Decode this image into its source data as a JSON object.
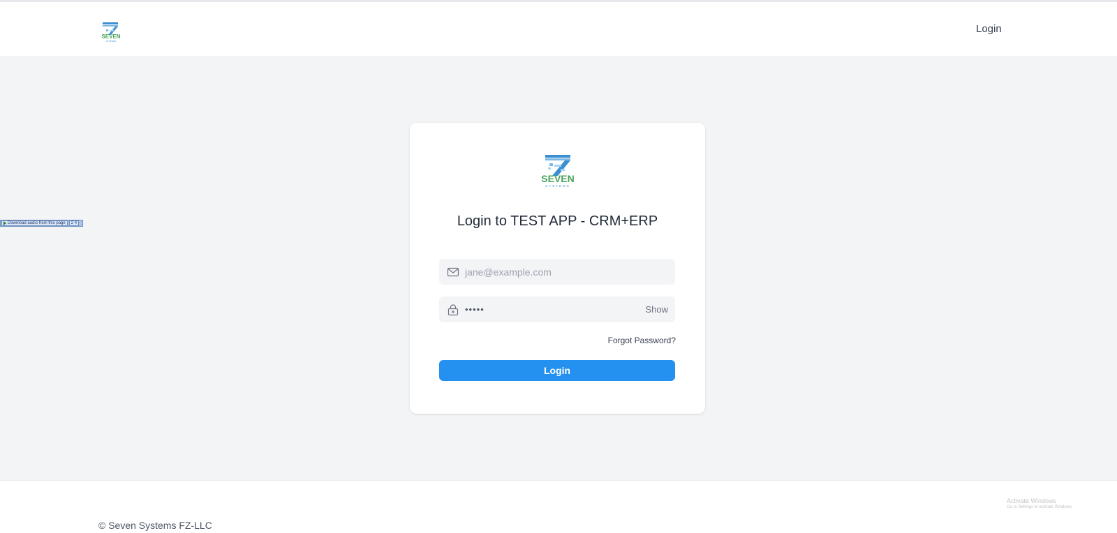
{
  "header": {
    "logo_alt": "SEVEN SYSTEMS",
    "login_link": "Login"
  },
  "extension_bar": {
    "download_label": "Download audio from this page",
    "secondary_label": "2 4"
  },
  "card": {
    "logo_alt": "SEVEN SYSTEMS",
    "title": "Login to TEST APP - CRM+ERP",
    "email": {
      "placeholder": "jane@example.com",
      "value": "",
      "icon": "mail-icon"
    },
    "password": {
      "masked_value": "•••••",
      "icon": "lock-icon",
      "show_label": "Show"
    },
    "forgot_password": "Forgot Password?",
    "login_button": "Login",
    "accent_color": "#2490ef"
  },
  "footer": {
    "copyright": "© Seven Systems FZ-LLC",
    "activate_title": "Activate Windows",
    "activate_subtitle": "Go to Settings to activate Windows."
  },
  "logo": {
    "word": "SEVEN",
    "subword": "SYSTEMS",
    "colors": {
      "green": "#4aa35a",
      "blue": "#3b8fd0"
    }
  }
}
